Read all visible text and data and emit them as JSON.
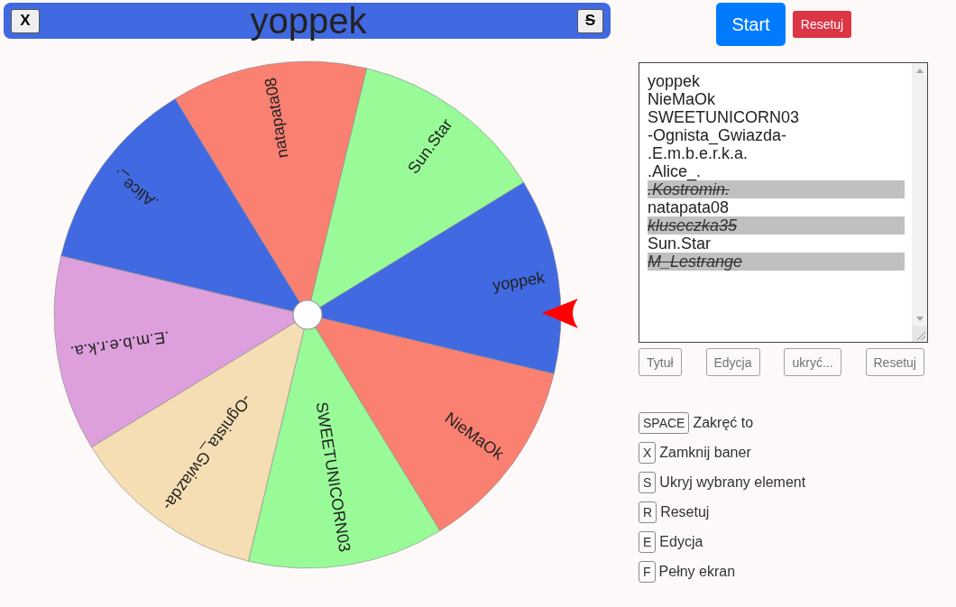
{
  "banner": {
    "close_button": "X",
    "title": "yoppek",
    "hide_button": {
      "label": "S",
      "struck": true
    }
  },
  "wheel": {
    "segments": [
      {
        "label": "yoppek",
        "color": "#4169e1"
      },
      {
        "label": "NieMaOk",
        "color": "#fa8072"
      },
      {
        "label": "SWEETUNICORN03",
        "color": "#98fb98"
      },
      {
        "label": "-Ognista_Gwiazda-",
        "color": "#f5deb3"
      },
      {
        "label": ".E.m.b.e.r.k.a.",
        "color": "#dda0dd"
      },
      {
        "label": ".Alice_.",
        "color": "#4169e1"
      },
      {
        "label": "natapata08",
        "color": "#fa8072"
      },
      {
        "label": "Sun.Star",
        "color": "#98fb98"
      }
    ]
  },
  "controls": {
    "start_button": "Start",
    "reset_button": "Resetuj"
  },
  "entries": [
    {
      "text": "yoppek",
      "hidden": false
    },
    {
      "text": "NieMaOk",
      "hidden": false
    },
    {
      "text": "SWEETUNICORN03",
      "hidden": false
    },
    {
      "text": "-Ognista_Gwiazda-",
      "hidden": false
    },
    {
      "text": ".E.m.b.e.r.k.a.",
      "hidden": false
    },
    {
      "text": ".Alice_.",
      "hidden": false
    },
    {
      "text": ".Kostromin.",
      "hidden": true
    },
    {
      "text": "natapata08",
      "hidden": false
    },
    {
      "text": "kluseczka35",
      "hidden": true
    },
    {
      "text": "Sun.Star",
      "hidden": false
    },
    {
      "text": "M_Lestrange",
      "hidden": true
    }
  ],
  "entry_buttons": [
    "Tytuł",
    "Edycja",
    "ukryć...",
    "Resetuj"
  ],
  "shortcuts": [
    {
      "key": "SPACE",
      "action": "Zakręć to"
    },
    {
      "key": "X",
      "action": "Zamknij baner"
    },
    {
      "key": "S",
      "action": "Ukryj wybrany element"
    },
    {
      "key": "R",
      "action": "Resetuj"
    },
    {
      "key": "E",
      "action": "Edycja"
    },
    {
      "key": "F",
      "action": "Pełny ekran"
    }
  ]
}
